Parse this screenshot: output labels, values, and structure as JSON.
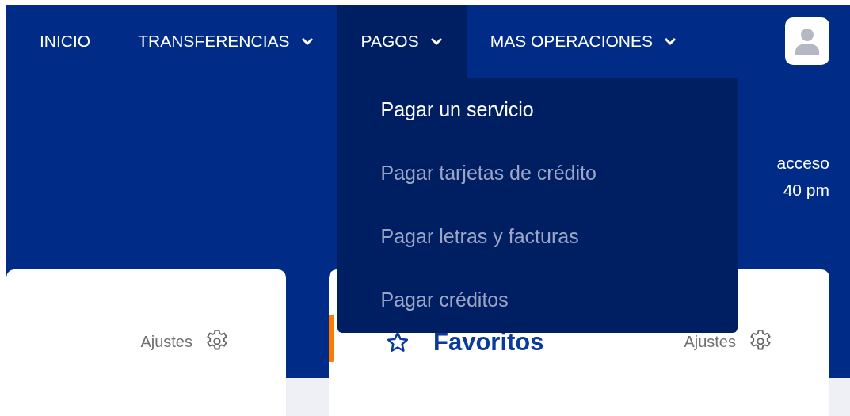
{
  "nav": {
    "items": [
      {
        "label": "INICIO",
        "dropdown": false,
        "selected": false
      },
      {
        "label": "TRANSFERENCIAS",
        "dropdown": true,
        "selected": false
      },
      {
        "label": "PAGOS",
        "dropdown": true,
        "selected": true
      },
      {
        "label": "MAS OPERACIONES",
        "dropdown": true,
        "selected": false
      }
    ]
  },
  "menu": {
    "items": [
      {
        "label": "Pagar un servicio",
        "selected": true
      },
      {
        "label": "Pagar tarjetas de crédito",
        "selected": false
      },
      {
        "label": "Pagar letras y facturas",
        "selected": false
      },
      {
        "label": "Pagar créditos",
        "selected": false
      }
    ]
  },
  "last_access": [
    "acceso",
    "40 pm"
  ],
  "cards": [
    {
      "settings_label": "Ajustes"
    },
    {
      "title": "Favoritos",
      "settings_label": "Ajustes"
    }
  ]
}
